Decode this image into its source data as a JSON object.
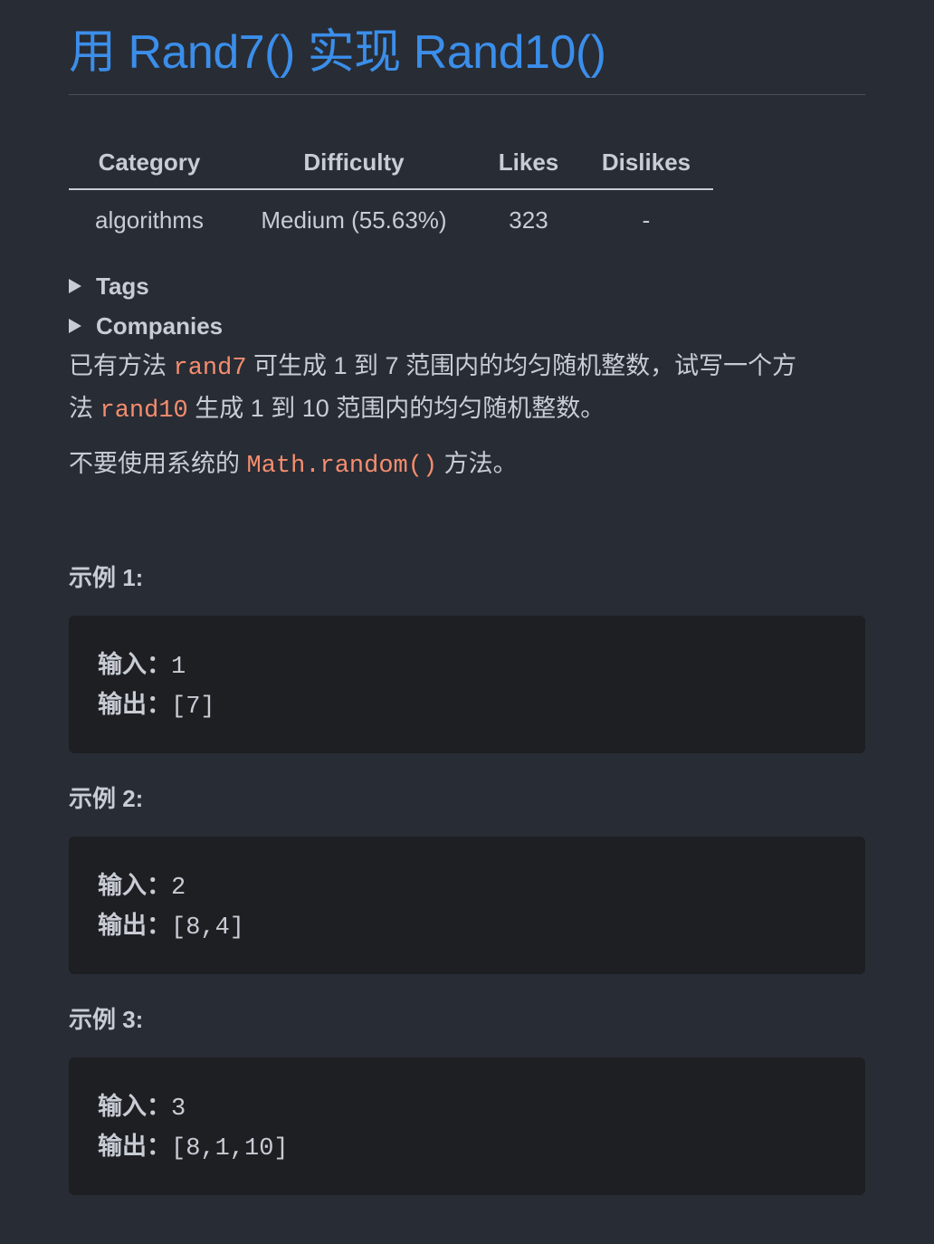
{
  "title": "用 Rand7() 实现 Rand10()",
  "meta": {
    "headers": [
      "Category",
      "Difficulty",
      "Likes",
      "Dislikes"
    ],
    "values": [
      "algorithms",
      "Medium (55.63%)",
      "323",
      "-"
    ]
  },
  "details": [
    {
      "label": "Tags"
    },
    {
      "label": "Companies"
    }
  ],
  "description": {
    "p1_part1": "已有方法 ",
    "p1_code1": "rand7",
    "p1_part2": " 可生成 1 到 7 范围内的均匀随机整数，试写一个方",
    "p1_part3": "法 ",
    "p1_code2": "rand10",
    "p1_part4": " 生成 1 到 10 范围内的均匀随机整数。",
    "p2_part1": "不要使用系统的 ",
    "p2_code": "Math.random()",
    "p2_part2": " 方法。"
  },
  "examples": [
    {
      "heading": "示例 1:",
      "input_label": "输入：",
      "input": "1",
      "output_label": "输出：",
      "output": "[7]"
    },
    {
      "heading": "示例 2:",
      "input_label": "输入：",
      "input": "2",
      "output_label": "输出：",
      "output": "[8,4]"
    },
    {
      "heading": "示例 3:",
      "input_label": "输入：",
      "input": "3",
      "output_label": "输出：",
      "output": "[8,1,10]"
    }
  ],
  "colors": {
    "background": "#282c34",
    "title": "#3b8eea",
    "code": "#f58d6f",
    "code_block_bg": "#1e1f23",
    "text": "#c8ccd4"
  }
}
